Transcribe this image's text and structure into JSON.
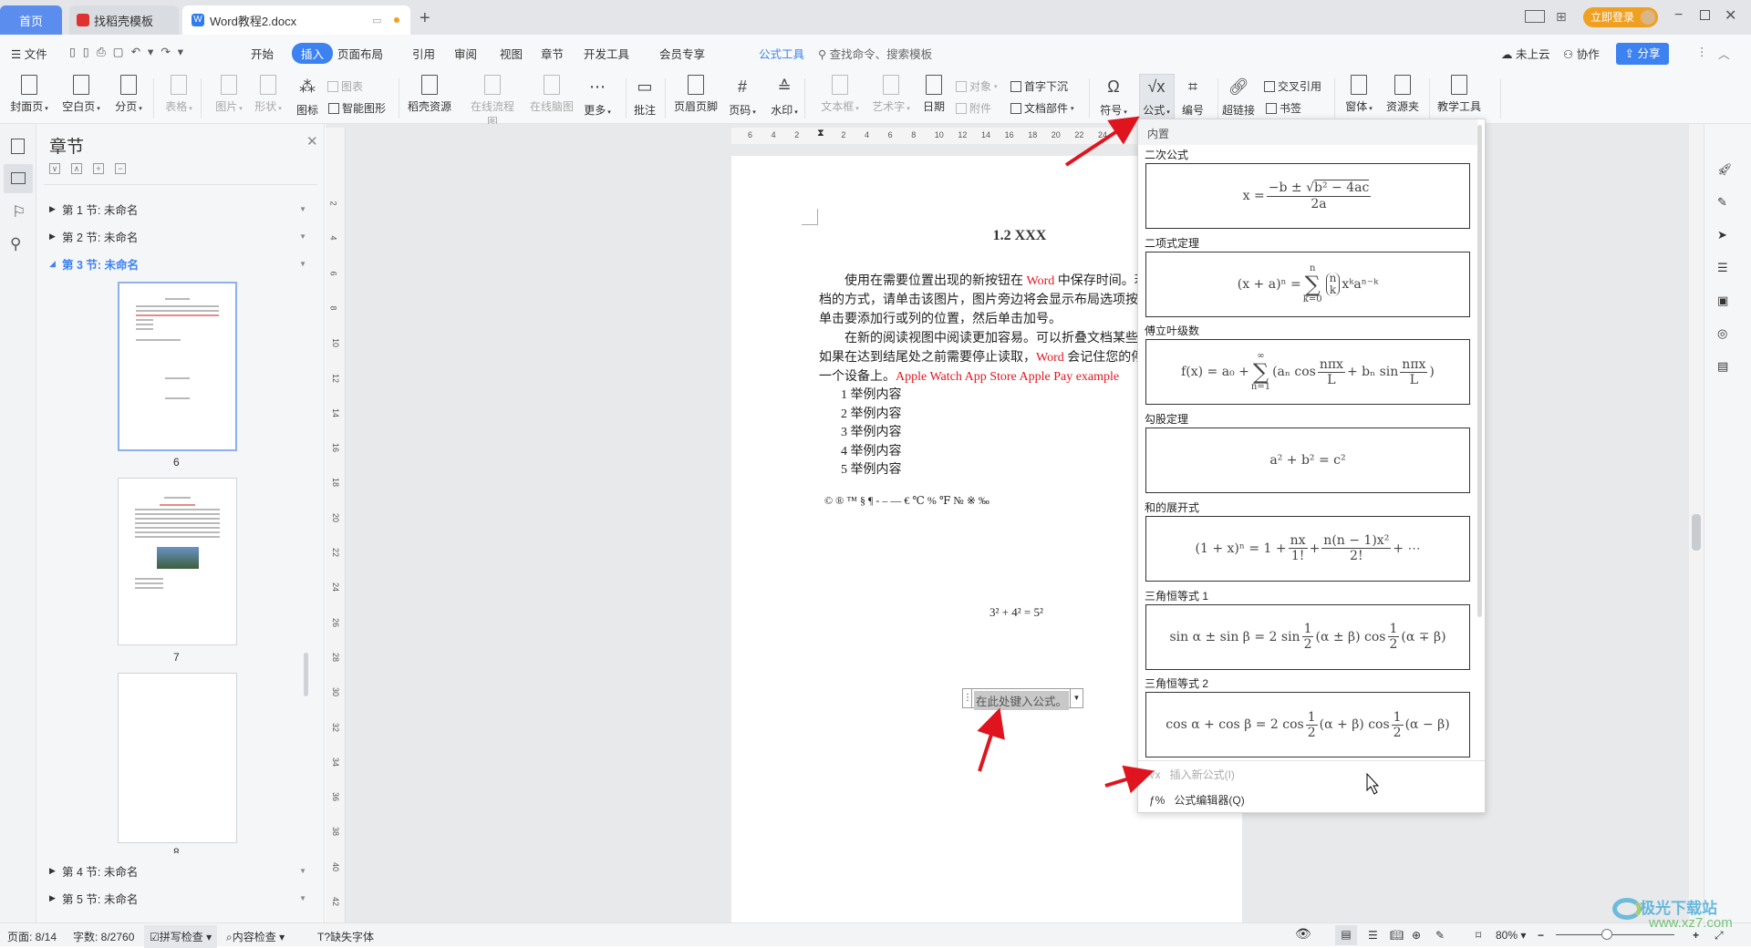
{
  "tabs": {
    "home": "首页",
    "template": "找稻壳模板",
    "doc": "Word教程2.docx",
    "new_tab": "+",
    "login": "立即登录",
    "colors": {
      "home": "#5b8def",
      "login": "#f0a020"
    }
  },
  "menu": {
    "file": "文件",
    "items": [
      "开始",
      "插入",
      "页面布局",
      "引用",
      "审阅",
      "视图",
      "章节",
      "开发工具",
      "会员专享"
    ],
    "active": "插入",
    "context_tab": "公式工具",
    "search": "查找命令、搜索模板",
    "cloud": "未上云",
    "collab": "协作",
    "share": "分享"
  },
  "ribbon": {
    "big": [
      {
        "label": "封面页",
        "dd": true
      },
      {
        "label": "空白页",
        "dd": true
      },
      {
        "label": "分页",
        "dd": true
      },
      {
        "label": "表格",
        "dd": true,
        "dis": true
      },
      {
        "label": "图片",
        "dd": true,
        "dis": true
      },
      {
        "label": "形状",
        "dd": true,
        "dis": true
      },
      {
        "label": "图标"
      },
      {
        "label": "稻壳资源"
      },
      {
        "label": "在线流程图",
        "dis": true
      },
      {
        "label": "在线脑图",
        "dis": true
      },
      {
        "label": "更多",
        "dd": true
      },
      {
        "label": "批注"
      },
      {
        "label": "页眉页脚"
      },
      {
        "label": "页码",
        "dd": true
      },
      {
        "label": "水印",
        "dd": true
      },
      {
        "label": "文本框",
        "dd": true,
        "dis": true
      },
      {
        "label": "艺术字",
        "dd": true,
        "dis": true
      },
      {
        "label": "日期"
      },
      {
        "label": "符号",
        "dd": true
      },
      {
        "label": "公式",
        "dd": true,
        "active": true
      },
      {
        "label": "编号"
      },
      {
        "label": "超链接"
      },
      {
        "label": "窗体",
        "dd": true
      },
      {
        "label": "资源夹"
      },
      {
        "label": "教学工具"
      }
    ],
    "small": [
      {
        "label": "图表",
        "dis": true
      },
      {
        "label": "智能图形"
      },
      {
        "label": "对象",
        "dd": true,
        "dis": true
      },
      {
        "label": "附件",
        "dis": true
      },
      {
        "label": "首字下沉"
      },
      {
        "label": "文档部件",
        "dd": true
      },
      {
        "label": "交叉引用"
      },
      {
        "label": "书签"
      }
    ]
  },
  "panel": {
    "title": "章节",
    "sections": [
      {
        "label": "第 1 节: 未命名"
      },
      {
        "label": "第 2 节: 未命名"
      },
      {
        "label": "第 3 节: 未命名",
        "expanded": true
      },
      {
        "label": "第 4 节: 未命名"
      },
      {
        "label": "第 5 节: 未命名"
      }
    ],
    "pages": [
      "6",
      "7",
      "8"
    ]
  },
  "ruler": {
    "top": [
      "6",
      "4",
      "2",
      "2",
      "4",
      "6",
      "8",
      "10",
      "12",
      "14",
      "16",
      "18",
      "20",
      "22",
      "24"
    ],
    "left": [
      "2",
      "4",
      "6",
      "8",
      "10",
      "12",
      "14",
      "16",
      "18",
      "20",
      "22",
      "24",
      "26",
      "28",
      "30",
      "32",
      "34",
      "36",
      "38",
      "40",
      "42"
    ]
  },
  "document": {
    "title": "1.2 XXX",
    "lines": [
      [
        {
          "t": "　　使用在需要位置出现的新按钮在 "
        },
        {
          "t": "Word",
          "red": true
        },
        {
          "t": " 中保存时间。若要"
        }
      ],
      [
        {
          "t": "档的方式，请单击该图片，图片旁边将会显示布局选项按钮。"
        }
      ],
      [
        {
          "t": "单击要添加行或列的位置，然后单击加号。"
        }
      ],
      [
        {
          "t": "　　在新的阅读视图中阅读更加容易。可以折叠文档某些部分并"
        }
      ],
      [
        {
          "t": "如果在达到结尾处之前需要停止读取，"
        },
        {
          "t": "Word",
          "red": true
        },
        {
          "t": " 会记住您的停止位"
        }
      ],
      [
        {
          "t": "一个设备上。"
        },
        {
          "t": "Apple Watch   App Store   Apple Pay   example",
          "red": true
        }
      ]
    ],
    "list": [
      "1  举例内容",
      "2  举例内容",
      "3  举例内容",
      "4  举例内容",
      "5  举例内容"
    ],
    "symbols": "© ® ™ § ¶ - – — € ℃ % ℉ № ※ ‰",
    "equation": "3² + 4² = 5²",
    "equation_placeholder": "在此处键入公式。"
  },
  "formula_menu": {
    "header": "内置",
    "items": [
      {
        "label": "二次公式",
        "tokens": [
          "x = ",
          {
            "f": [
              [
                "−b ± ",
                {
                  "sqrt": "b² − 4ac"
                }
              ],
              "2a"
            ]
          }
        ]
      },
      {
        "label": "二项式定理",
        "tokens": [
          "(x + a)ⁿ = ",
          {
            "sum": [
              "n",
              "k=0"
            ]
          },
          {
            "binom": [
              "n",
              "k"
            ]
          },
          "xᵏaⁿ⁻ᵏ"
        ]
      },
      {
        "label": "傅立叶级数",
        "tokens": [
          "f(x) = a₀ + ",
          {
            "sum": [
              "∞",
              "n=1"
            ]
          },
          "(aₙ cos",
          {
            "f": [
              "nπx",
              "L"
            ]
          },
          " + bₙ sin",
          {
            "f": [
              "nπx",
              "L"
            ]
          },
          ")"
        ]
      },
      {
        "label": "勾股定理",
        "tokens": [
          "a² + b² = c²"
        ]
      },
      {
        "label": "和的展开式",
        "tokens": [
          "(1 + x)ⁿ = 1 + ",
          {
            "f": [
              "nx",
              "1!"
            ]
          },
          " + ",
          {
            "f": [
              "n(n − 1)x²",
              "2!"
            ]
          },
          " + ⋯"
        ]
      },
      {
        "label": "三角恒等式 1",
        "tokens": [
          "sin α ± sin β = 2 sin",
          {
            "f": [
              "1",
              "2"
            ]
          },
          "(α ± β) cos",
          {
            "f": [
              "1",
              "2"
            ]
          },
          "(α ∓ β)"
        ]
      },
      {
        "label": "三角恒等式 2",
        "tokens": [
          "cos α + cos β = 2 cos",
          {
            "f": [
              "1",
              "2"
            ]
          },
          "(α + β) cos",
          {
            "f": [
              "1",
              "2"
            ]
          },
          "(α − β)"
        ]
      }
    ],
    "insert_new": "插入新公式(I)",
    "editor": "公式编辑器(Q)"
  },
  "status": {
    "page": "页面: 8/14",
    "words": "字数: 8/2760",
    "spell": "拼写检查",
    "content": "内容检查",
    "missing_font": "缺失字体",
    "zoom": "80%",
    "zoom_level": 80
  },
  "watermark": {
    "name": "极光下载站",
    "url": "www.xz7.com"
  },
  "colors": {
    "accent": "#3c82f0",
    "annotation_arrow": "#e0141e"
  }
}
